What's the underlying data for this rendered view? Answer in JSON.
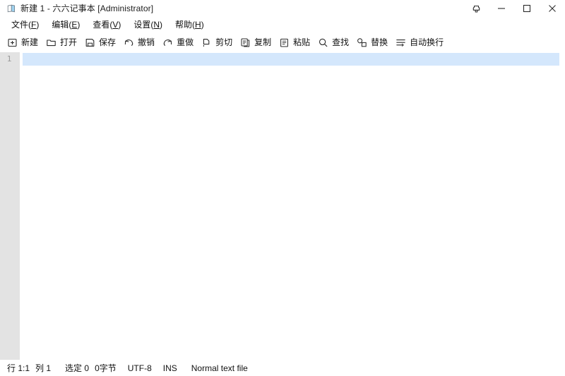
{
  "window": {
    "title": "新建 1 - 六六记事本 [Administrator]",
    "app_icon": "notepad-document-icon",
    "caption_buttons": [
      {
        "name": "pin-on-top-button",
        "icon": "pin-icon",
        "label": "置顶"
      },
      {
        "name": "minimize-button",
        "icon": "minimize-icon",
        "label": "最小化"
      },
      {
        "name": "maximize-button",
        "icon": "maximize-icon",
        "label": "最大化"
      },
      {
        "name": "close-button",
        "icon": "close-icon",
        "label": "关闭"
      }
    ]
  },
  "menubar": {
    "items": [
      {
        "label": "文件(F)",
        "text": "文件(",
        "mnemonic": "F",
        "tail": ")"
      },
      {
        "label": "编辑(E)",
        "text": "编辑(",
        "mnemonic": "E",
        "tail": ")"
      },
      {
        "label": "查看(V)",
        "text": "查看(",
        "mnemonic": "V",
        "tail": ")"
      },
      {
        "label": "设置(N)",
        "text": "设置(",
        "mnemonic": "N",
        "tail": ")"
      },
      {
        "label": "帮助(H)",
        "text": "帮助(",
        "mnemonic": "H",
        "tail": ")"
      }
    ]
  },
  "toolbar": {
    "items": [
      {
        "label": "新建",
        "icon": "new-file-icon"
      },
      {
        "label": "打开",
        "icon": "open-folder-icon"
      },
      {
        "label": "保存",
        "icon": "save-floppy-icon"
      },
      {
        "label": "撤销",
        "icon": "undo-arrow-icon"
      },
      {
        "label": "重做",
        "icon": "redo-arrow-icon"
      },
      {
        "label": "剪切",
        "icon": "cut-scissors-icon"
      },
      {
        "label": "复制",
        "icon": "copy-icon"
      },
      {
        "label": "粘贴",
        "icon": "paste-icon"
      },
      {
        "label": "查找",
        "icon": "search-icon"
      },
      {
        "label": "替换",
        "icon": "replace-icon"
      },
      {
        "label": "自动换行",
        "icon": "word-wrap-icon"
      }
    ]
  },
  "editor": {
    "line_numbers": [
      "1"
    ],
    "content": "",
    "current_line": 1
  },
  "statusbar": {
    "position": "行 1:1",
    "column": "列 1",
    "selection": "选定 0",
    "size": "0字节",
    "encoding": "UTF-8",
    "insert_mode": "INS",
    "file_type": "Normal text file"
  },
  "colors": {
    "window_bg": "#ffffff",
    "gutter_bg": "#e3e3e3",
    "gutter_text": "#9a9a9a",
    "current_line_highlight": "#d4e7fc",
    "text": "#111111",
    "icon_stroke": "#2b2b2b"
  }
}
